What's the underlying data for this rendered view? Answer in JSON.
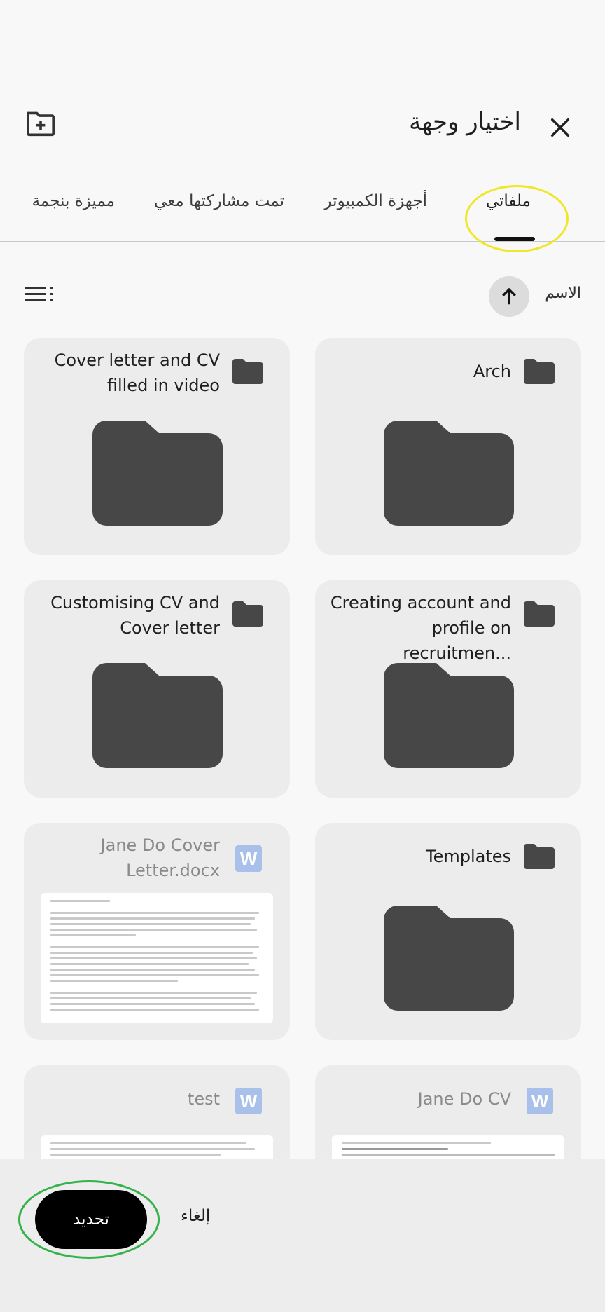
{
  "header": {
    "title": "اختيار وجهة",
    "close_icon": "close-icon",
    "new_folder_icon": "create-new-folder-icon"
  },
  "tabs": [
    {
      "label": "ملفاتي",
      "active": true
    },
    {
      "label": "أجهزة الكمبيوتر",
      "active": false
    },
    {
      "label": "تمت مشاركتها معي",
      "active": false
    },
    {
      "label": "مميزة بنجمة",
      "active": false
    }
  ],
  "sort": {
    "label": "الاسم",
    "direction_icon": "arrow-up-icon",
    "view_icon": "list-view-icon"
  },
  "items": [
    {
      "name": "Arch",
      "type": "folder"
    },
    {
      "name": "Cover letter and CV filled in video",
      "type": "folder"
    },
    {
      "name": "Creating account and profile on recruitmen...",
      "type": "folder"
    },
    {
      "name": "Customising CV and Cover letter",
      "type": "folder"
    },
    {
      "name": "Templates",
      "type": "folder"
    },
    {
      "name": "Jane Do Cover Letter.docx",
      "type": "docx"
    },
    {
      "name": "Jane Do CV",
      "type": "docx"
    },
    {
      "name": "test",
      "type": "docx"
    }
  ],
  "word_icon_letter": "W",
  "footer": {
    "update_label": "تحديد",
    "cancel_label": "إلغاء"
  },
  "colors": {
    "folder": "#474747",
    "word_badge": "#a8c0ea",
    "yellow_annotation": "#f0e62a",
    "green_annotation": "#35b24a"
  }
}
